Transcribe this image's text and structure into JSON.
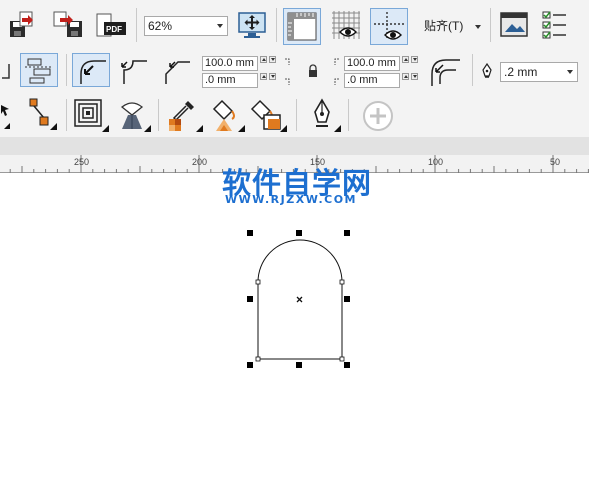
{
  "toolbar_top": {
    "zoom_value": "62%",
    "snap_label": "贴齐(T)",
    "icons": [
      "import-icon",
      "export-icon",
      "publish-pdf-icon",
      "full-screen-preview-icon",
      "show-rulers-icon",
      "show-grid-icon",
      "show-guidelines-icon",
      "snap-to-icon",
      "options-icon",
      "application-launcher-icon"
    ]
  },
  "property_bar": {
    "width_value": "100.0 mm",
    "height_value": ".0 mm",
    "corner_width_value": "100.0 mm",
    "corner_height_value": ".0 mm",
    "outline_width_value": ".2 mm"
  },
  "ruler": {
    "labels": [
      "250",
      "200",
      "150",
      "100",
      "50"
    ]
  },
  "watermark": {
    "title": "软件自学网",
    "url": "WWW.RJZXW.COM"
  },
  "colors": {
    "toolbar_bg": "#f3f3f3",
    "watermark": "#1d6fd0",
    "active_button": "#dce9f7",
    "orange_node": "#e07a1f"
  }
}
